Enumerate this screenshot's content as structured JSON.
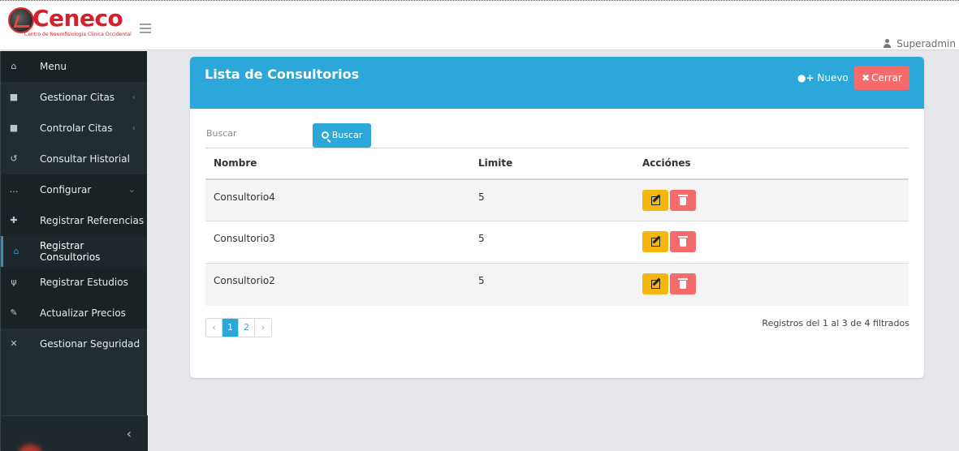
{
  "brand": {
    "name": "Ceneco",
    "subtitle": "Centro de Neurofisiología Clínica Occidental"
  },
  "header": {
    "user": "Superadmin"
  },
  "sidebar": {
    "items": [
      {
        "label": "Menu",
        "icon": "home-icon"
      },
      {
        "label": "Gestionar Citas",
        "icon": "clipboard-icon",
        "caret": "‹"
      },
      {
        "label": "Controlar Citas",
        "icon": "clipboard-icon",
        "caret": "‹"
      },
      {
        "label": "Consultar Historial",
        "icon": "history-icon"
      },
      {
        "label": "Configurar",
        "icon": "ellipsis-icon",
        "caret": "⌄"
      },
      {
        "label": "Registrar Referencias",
        "icon": "user-plus-icon"
      },
      {
        "label": "Registrar Consultorios",
        "icon": "home-icon"
      },
      {
        "label": "Registrar Estudios",
        "icon": "stethoscope-icon"
      },
      {
        "label": "Actualizar Precios",
        "icon": "edit-icon"
      },
      {
        "label": "Gestionar Seguridad",
        "icon": "tools-icon",
        "caret": "‹"
      }
    ],
    "collapse": "‹"
  },
  "panel": {
    "title": "Lista de Consultorios",
    "new_label": "Nuevo",
    "close_label": "Cerrar",
    "search_placeholder": "Buscar",
    "search_button": "Buscar"
  },
  "table": {
    "headers": [
      "Nombre",
      "Limite",
      "Acciónes"
    ],
    "rows": [
      {
        "nombre": "Consultorio4",
        "limite": "5"
      },
      {
        "nombre": "Consultorio3",
        "limite": "5"
      },
      {
        "nombre": "Consultorio2",
        "limite": "5"
      }
    ]
  },
  "pagination": {
    "prev": "‹",
    "pages": [
      "1",
      "2"
    ],
    "next": "›",
    "current": "1",
    "summary": "Registros del 1 al 3 de 4 filtrados"
  },
  "colors": {
    "accent": "#2ba7d9",
    "sidebar": "#222d32",
    "edit": "#f5b70f",
    "delete": "#f56a6a"
  }
}
